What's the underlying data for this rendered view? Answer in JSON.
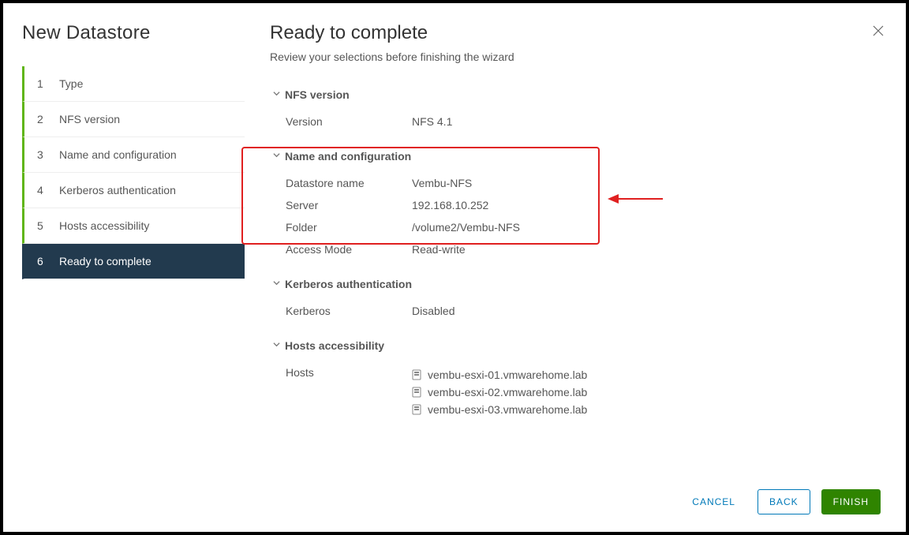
{
  "wizard": {
    "title": "New Datastore",
    "steps": [
      {
        "num": "1",
        "label": "Type"
      },
      {
        "num": "2",
        "label": "NFS version"
      },
      {
        "num": "3",
        "label": "Name and configuration"
      },
      {
        "num": "4",
        "label": "Kerberos authentication"
      },
      {
        "num": "5",
        "label": "Hosts accessibility"
      },
      {
        "num": "6",
        "label": "Ready to complete"
      }
    ]
  },
  "main": {
    "title": "Ready to complete",
    "subtitle": "Review your selections before finishing the wizard",
    "sections": {
      "nfs": {
        "header": "NFS version",
        "version_label": "Version",
        "version_value": "NFS 4.1"
      },
      "nameconf": {
        "header": "Name and configuration",
        "datastore_label": "Datastore name",
        "datastore_value": "Vembu-NFS",
        "server_label": "Server",
        "server_value": "192.168.10.252",
        "folder_label": "Folder",
        "folder_value": "/volume2/Vembu-NFS",
        "access_label": "Access Mode",
        "access_value": "Read-write"
      },
      "kerberos": {
        "header": "Kerberos authentication",
        "k_label": "Kerberos",
        "k_value": "Disabled"
      },
      "hosts": {
        "header": "Hosts accessibility",
        "hosts_label": "Hosts",
        "list": [
          "vembu-esxi-01.vmwarehome.lab",
          "vembu-esxi-02.vmwarehome.lab",
          "vembu-esxi-03.vmwarehome.lab"
        ]
      }
    }
  },
  "footer": {
    "cancel": "CANCEL",
    "back": "BACK",
    "finish": "FINISH"
  }
}
